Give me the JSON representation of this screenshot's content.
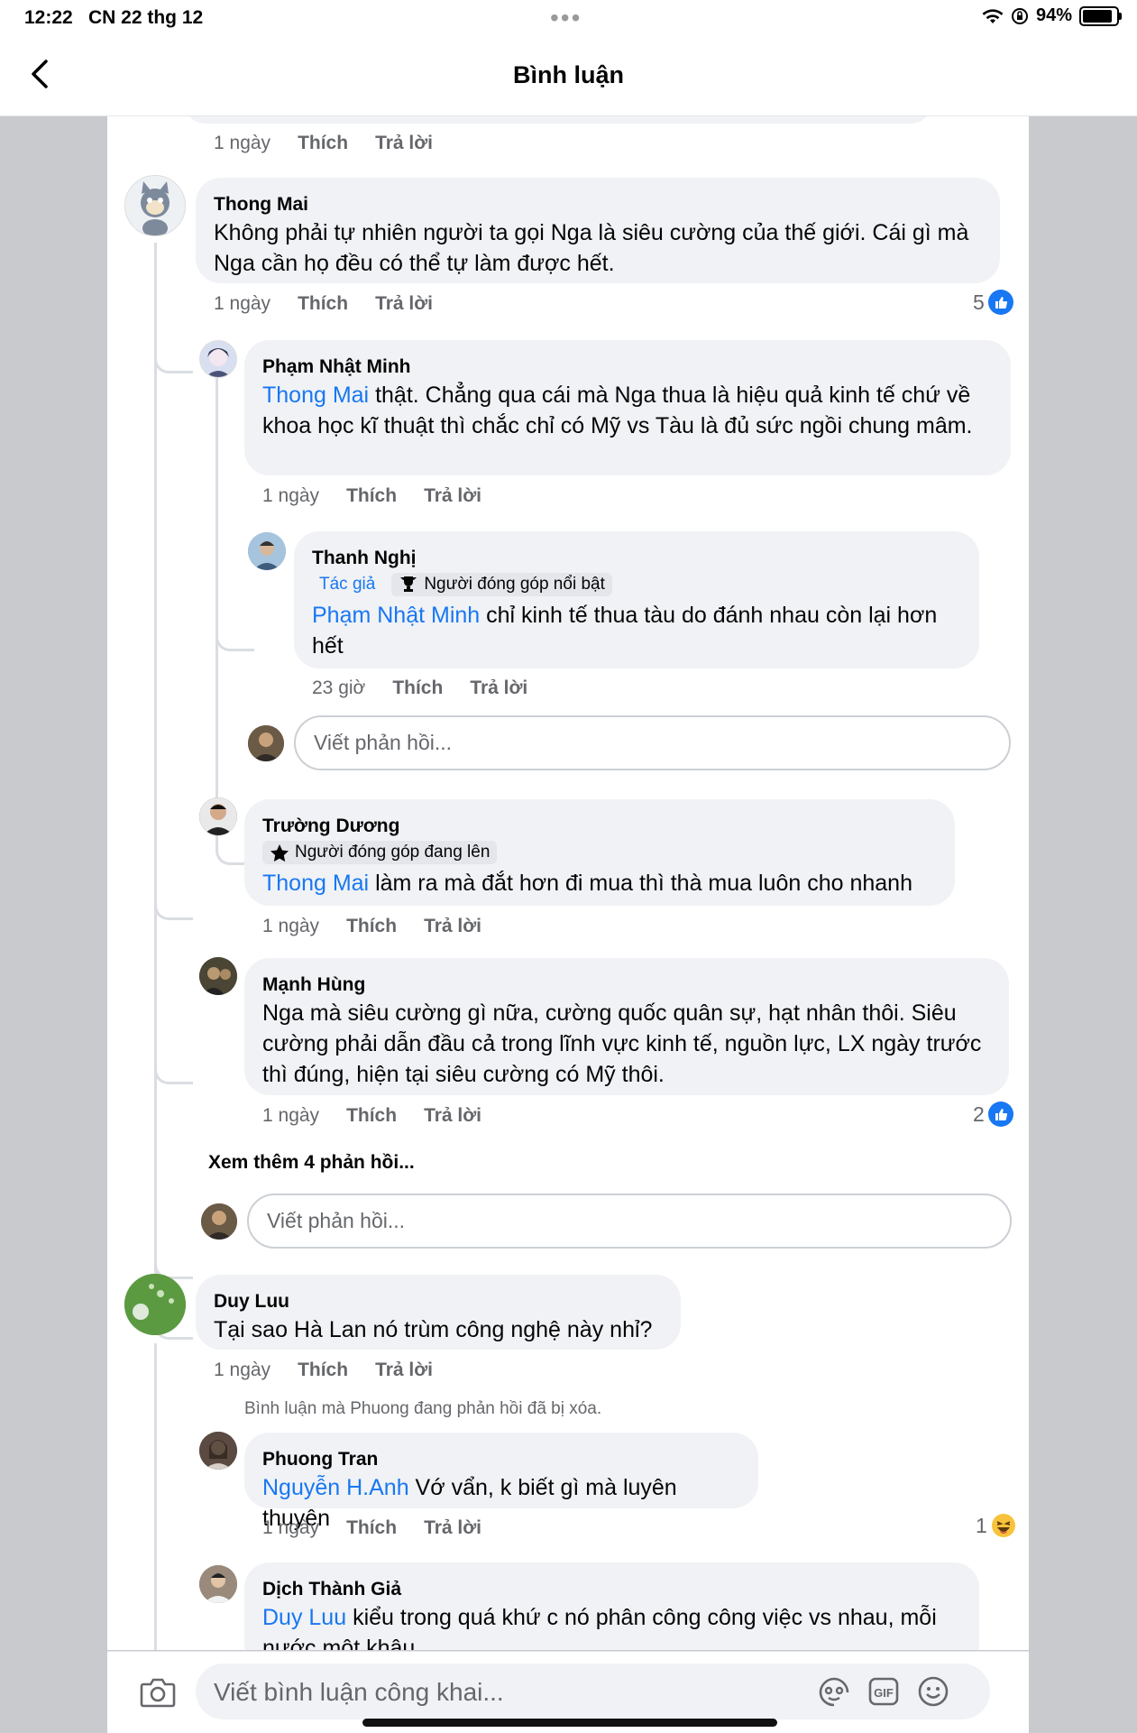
{
  "status": {
    "time": "12:22",
    "date": "CN 22 thg 12",
    "battery": "94%"
  },
  "header": {
    "title": "Bình luận"
  },
  "top_meta": {
    "time": "1 ngày",
    "like": "Thích",
    "reply": "Trả lời"
  },
  "common": {
    "like": "Thích",
    "reply": "Trả lời",
    "reply_placeholder": "Viết phản hồi..."
  },
  "comments": {
    "thong": {
      "name": "Thong Mai",
      "text": "Không phải tự nhiên người ta gọi Nga là siêu cường của thế giới. Cái gì mà Nga cần họ đều có thể tự làm được hết.",
      "time": "1 ngày",
      "reactions": "5"
    },
    "minh": {
      "name": "Phạm Nhật Minh",
      "mention": "Thong Mai",
      "text": " thật. Chẳng qua cái mà Nga thua là hiệu quả kinh tế chứ về khoa học kĩ thuật thì chắc chỉ có Mỹ vs Tàu là đủ sức ngồi chung mâm.",
      "time": "1 ngày"
    },
    "nghi": {
      "name": "Thanh Nghị",
      "author_badge": "Tác giả",
      "badge": "Người đóng góp nổi bật",
      "mention": "Phạm Nhật Minh",
      "text": " chỉ kinh tế thua tàu do đánh nhau còn lại hơn hết",
      "time": "23 giờ"
    },
    "duong": {
      "name": "Trường Dương",
      "badge": "Người đóng góp đang lên",
      "mention": "Thong Mai",
      "text": " làm ra mà đắt hơn đi mua thì thà mua luôn cho nhanh",
      "time": "1 ngày"
    },
    "hung": {
      "name": "Mạnh Hùng",
      "text": "Nga mà siêu cường gì nữa, cường quốc quân sự, hạt nhân thôi. Siêu cường phải dẫn đầu cả trong lĩnh vực kinh tế, nguồn lực, LX ngày trước thì đúng, hiện tại siêu cường có Mỹ thôi.",
      "time": "1 ngày",
      "reactions": "2"
    },
    "more_replies": "Xem thêm 4 phản hồi...",
    "duy": {
      "name": "Duy Luu",
      "text": "Tại sao Hà Lan nó trùm công nghệ này nhỉ?",
      "time": "1 ngày"
    },
    "deleted_note": "Bình luận mà Phuong đang phản hồi đã bị xóa.",
    "phuong": {
      "name": "Phuong Tran",
      "mention": "Nguyễn H.Anh",
      "text": " Vớ vẩn, k biết gì mà luyên thuyên",
      "time": "1 ngày",
      "reactions": "1"
    },
    "dich": {
      "name": "Dịch Thành Giả",
      "mention": "Duy Luu",
      "text": " kiểu trong quá khứ c nó phân công công việc vs nhau, mỗi nước một khâu"
    }
  },
  "bottom": {
    "placeholder": "Viết bình luận công khai..."
  },
  "icons": [
    "back-icon",
    "camera-icon",
    "avatar-sticker-icon",
    "gif-icon",
    "emoji-icon",
    "wifi-icon",
    "like-icon",
    "haha-icon",
    "trophy-icon",
    "star-icon"
  ],
  "colors": {
    "accent": "#1877f2",
    "bubble": "#f0f2f5",
    "muted": "#65676b"
  }
}
